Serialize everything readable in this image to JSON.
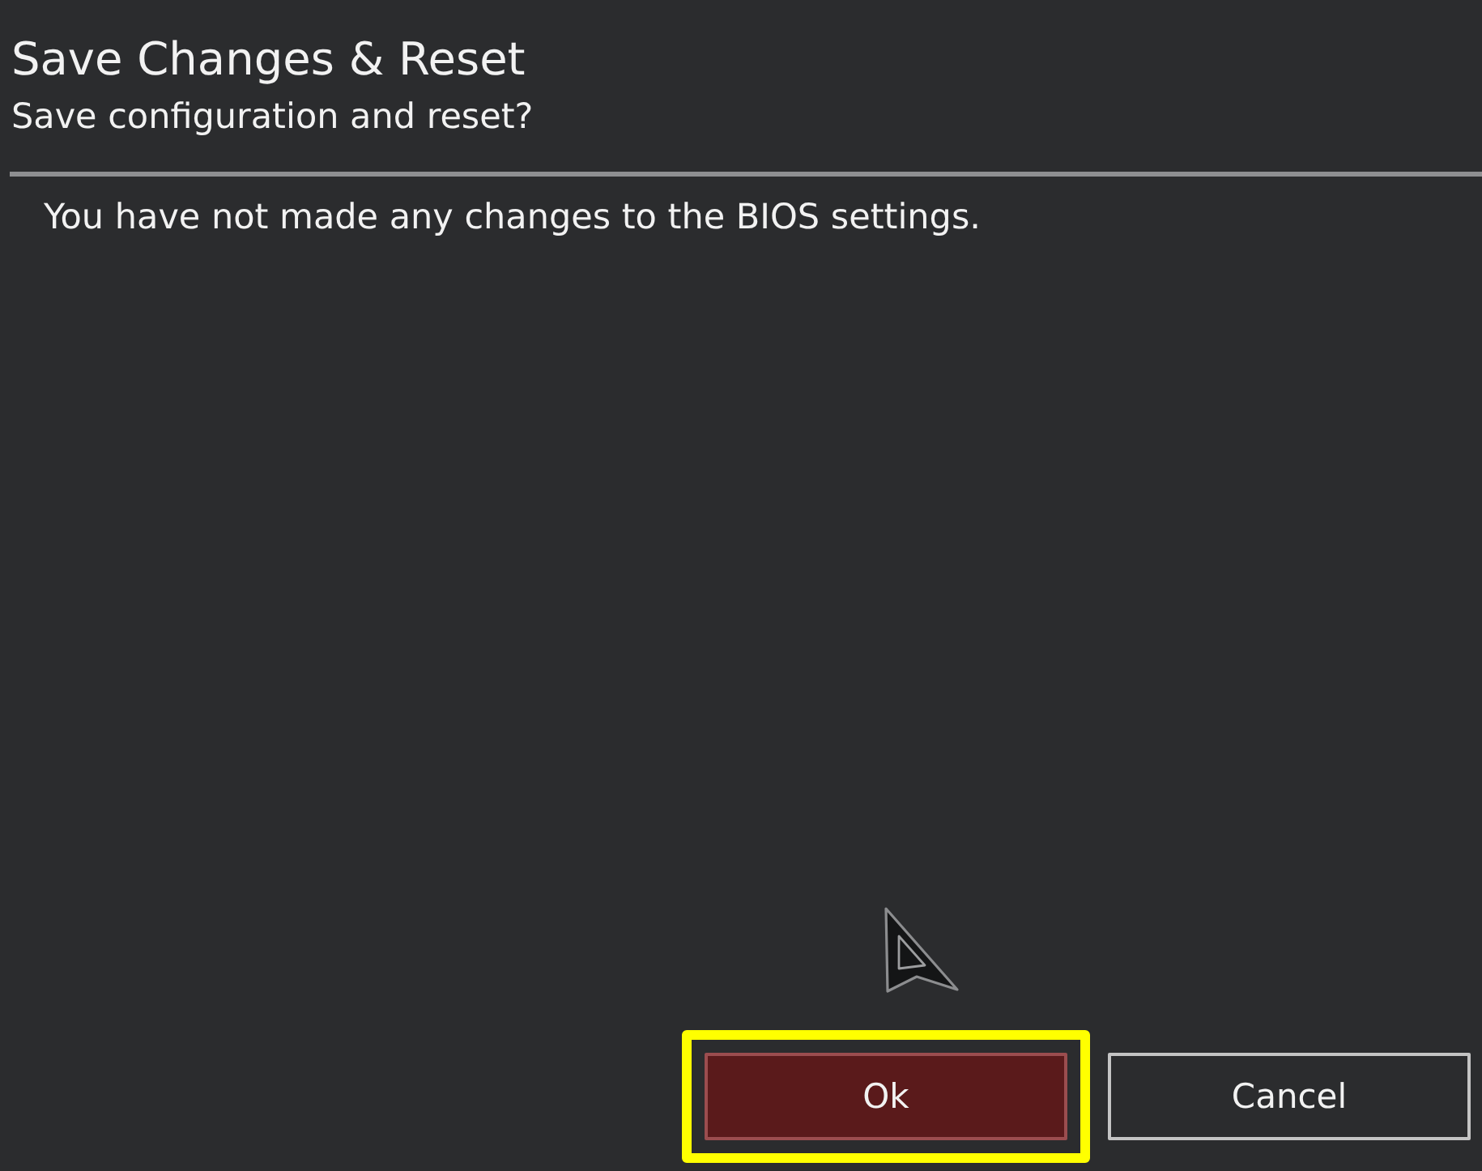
{
  "dialog": {
    "title": "Save Changes & Reset",
    "subtitle": "Save configuration and reset?"
  },
  "message": "You have not made any changes to the BIOS settings.",
  "buttons": [
    {
      "label": "Ok",
      "selected": true,
      "highlighted": true
    },
    {
      "label": "Cancel",
      "selected": false,
      "highlighted": false
    }
  ]
}
